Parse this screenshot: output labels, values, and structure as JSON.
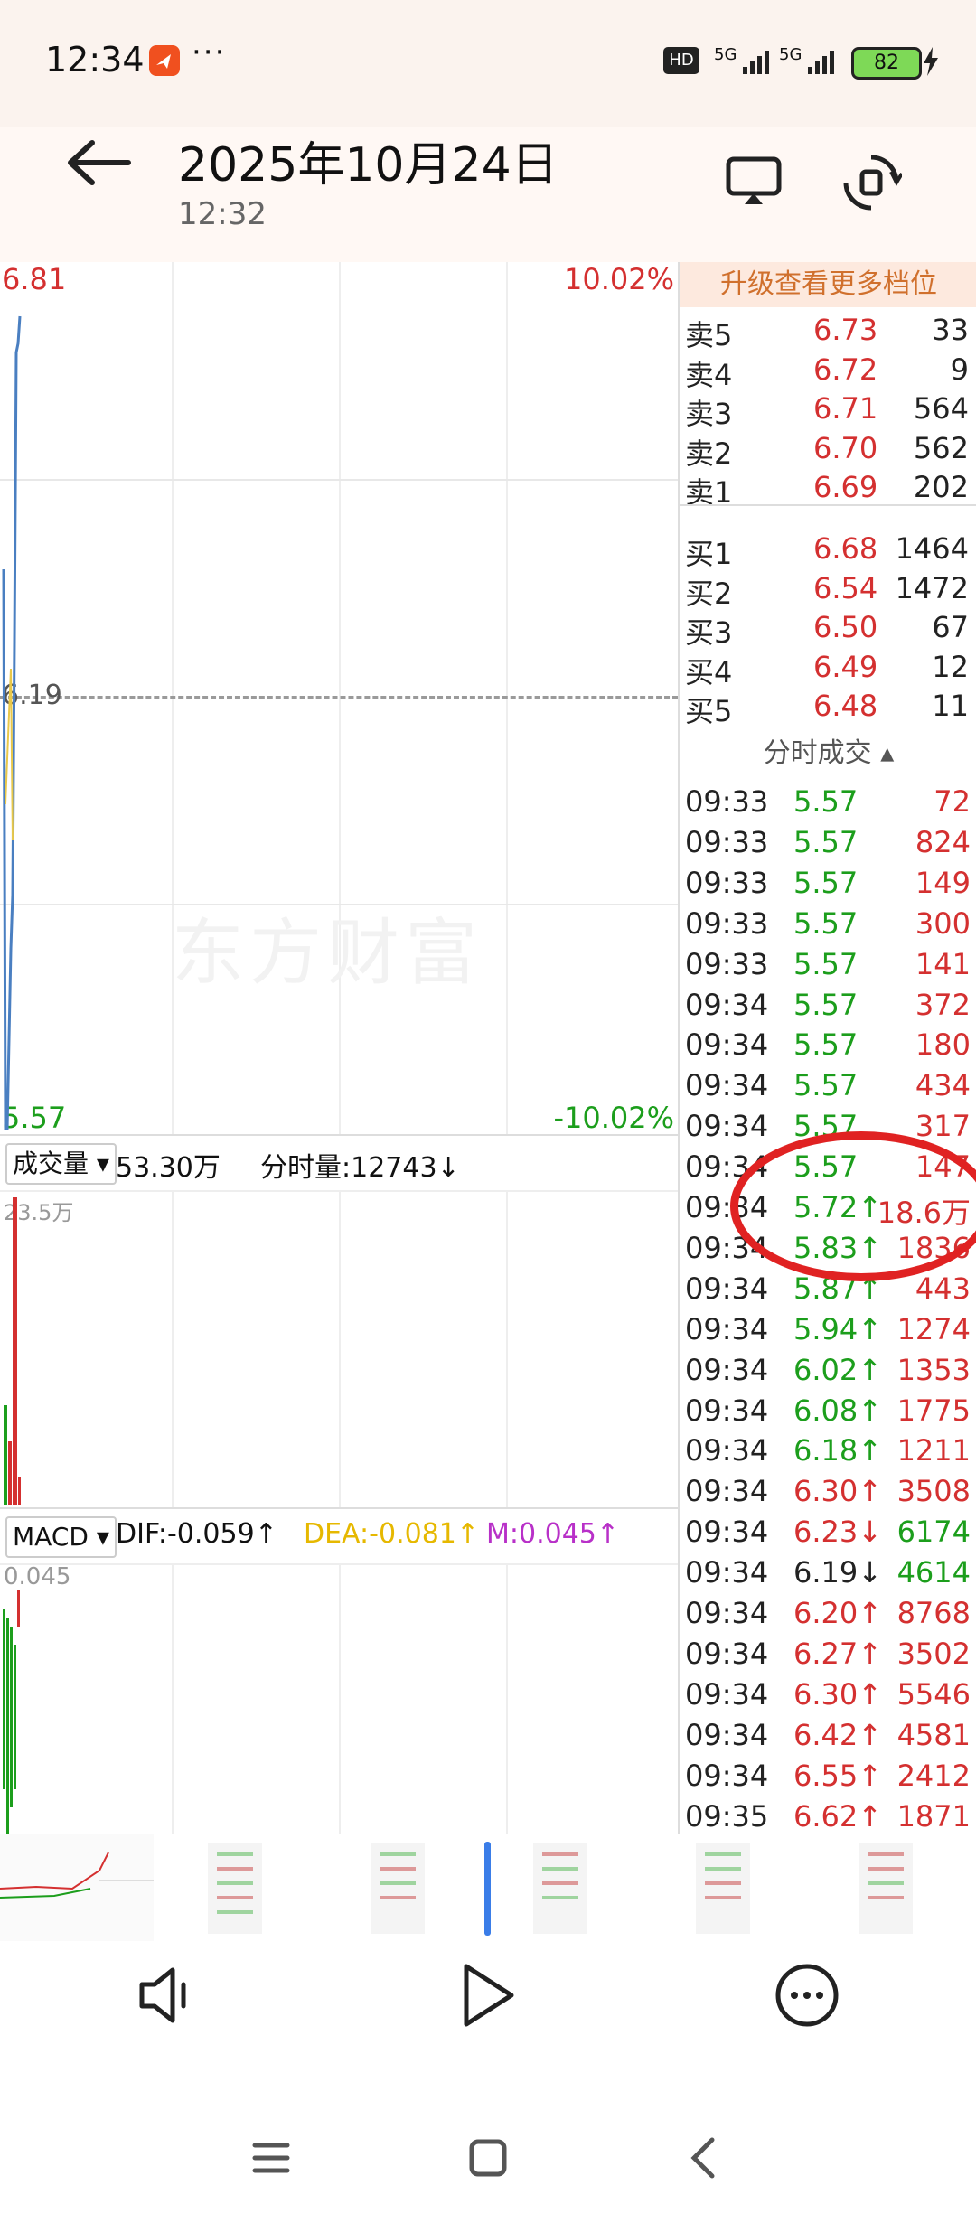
{
  "status_bar": {
    "time": "12:34",
    "dots": "···",
    "hd_badge": "HD",
    "network_1": "5G",
    "network_2": "5G",
    "battery": "82",
    "app_icon": "app-notification-icon"
  },
  "header": {
    "date_title": "2025年10月24日",
    "time_subtitle": "12:32",
    "back_icon": "arrow-left-icon",
    "cast_icon": "cast-screen-icon",
    "rotate_icon": "rotate-screen-icon"
  },
  "chart": {
    "top_price_label": "6.81",
    "top_pct_label": "10.02%",
    "mid_price_label": "6.19",
    "bottom_price_label": "5.57",
    "bottom_pct_label": "-10.02%",
    "watermark": "东方财富",
    "volume_header": {
      "selector_label": "成交量",
      "total": "53.30万",
      "tick_volume": "分时量:12743↓"
    },
    "volume_axis_label": "23.5万",
    "macd_header": {
      "selector_label": "MACD",
      "dif": "DIF:-0.059↑",
      "dea": "DEA:-0.081↑",
      "m": "M:0.045↑"
    },
    "macd_axis_label": "0.045",
    "colors": {
      "up": "#d43030",
      "down": "#1c9e1c",
      "price_line": "#4a7fc1",
      "avg_line": "#e8c84a",
      "dea": "#e6b800",
      "m": "#b830c8"
    }
  },
  "order_book": {
    "upgrade_label": "升级查看更多档位",
    "asks": [
      {
        "label": "卖5",
        "price": "6.73",
        "volume": "33"
      },
      {
        "label": "卖4",
        "price": "6.72",
        "volume": "9"
      },
      {
        "label": "卖3",
        "price": "6.71",
        "volume": "564"
      },
      {
        "label": "卖2",
        "price": "6.70",
        "volume": "562"
      },
      {
        "label": "卖1",
        "price": "6.69",
        "volume": "202"
      }
    ],
    "bids": [
      {
        "label": "买1",
        "price": "6.68",
        "volume": "1464"
      },
      {
        "label": "买2",
        "price": "6.54",
        "volume": "1472"
      },
      {
        "label": "买3",
        "price": "6.50",
        "volume": "67"
      },
      {
        "label": "买4",
        "price": "6.49",
        "volume": "12"
      },
      {
        "label": "买5",
        "price": "6.48",
        "volume": "11"
      }
    ]
  },
  "trades": {
    "title": "分时成交 ▴",
    "rows": [
      {
        "time": "09:33",
        "price": "5.57",
        "volume": "72",
        "pc": "green",
        "vc": "red"
      },
      {
        "time": "09:33",
        "price": "5.57",
        "volume": "824",
        "pc": "green",
        "vc": "red"
      },
      {
        "time": "09:33",
        "price": "5.57",
        "volume": "149",
        "pc": "green",
        "vc": "red"
      },
      {
        "time": "09:33",
        "price": "5.57",
        "volume": "300",
        "pc": "green",
        "vc": "red"
      },
      {
        "time": "09:33",
        "price": "5.57",
        "volume": "141",
        "pc": "green",
        "vc": "red"
      },
      {
        "time": "09:34",
        "price": "5.57",
        "volume": "372",
        "pc": "green",
        "vc": "red"
      },
      {
        "time": "09:34",
        "price": "5.57",
        "volume": "180",
        "pc": "green",
        "vc": "red"
      },
      {
        "time": "09:34",
        "price": "5.57",
        "volume": "434",
        "pc": "green",
        "vc": "red"
      },
      {
        "time": "09:34",
        "price": "5.57",
        "volume": "317",
        "pc": "green",
        "vc": "red"
      },
      {
        "time": "09:34",
        "price": "5.57",
        "volume": "147",
        "pc": "green",
        "vc": "red"
      },
      {
        "time": "09:34",
        "price": "5.72↑",
        "volume": "18.6万",
        "pc": "green",
        "vc": "red"
      },
      {
        "time": "09:34",
        "price": "5.83↑",
        "volume": "1836",
        "pc": "green",
        "vc": "red"
      },
      {
        "time": "09:34",
        "price": "5.87↑",
        "volume": "443",
        "pc": "green",
        "vc": "red"
      },
      {
        "time": "09:34",
        "price": "5.94↑",
        "volume": "1274",
        "pc": "green",
        "vc": "red"
      },
      {
        "time": "09:34",
        "price": "6.02↑",
        "volume": "1353",
        "pc": "green",
        "vc": "red"
      },
      {
        "time": "09:34",
        "price": "6.08↑",
        "volume": "1775",
        "pc": "green",
        "vc": "red"
      },
      {
        "time": "09:34",
        "price": "6.18↑",
        "volume": "1211",
        "pc": "green",
        "vc": "red"
      },
      {
        "time": "09:34",
        "price": "6.30↑",
        "volume": "3508",
        "pc": "red",
        "vc": "red"
      },
      {
        "time": "09:34",
        "price": "6.23↓",
        "volume": "6174",
        "pc": "red",
        "vc": "green"
      },
      {
        "time": "09:34",
        "price": "6.19↓",
        "volume": "4614",
        "pc": "dark",
        "vc": "green"
      },
      {
        "time": "09:34",
        "price": "6.20↑",
        "volume": "8768",
        "pc": "red",
        "vc": "red"
      },
      {
        "time": "09:34",
        "price": "6.27↑",
        "volume": "3502",
        "pc": "red",
        "vc": "red"
      },
      {
        "time": "09:34",
        "price": "6.30↑",
        "volume": "5546",
        "pc": "red",
        "vc": "red"
      },
      {
        "time": "09:34",
        "price": "6.42↑",
        "volume": "4581",
        "pc": "red",
        "vc": "red"
      },
      {
        "time": "09:34",
        "price": "6.55↑",
        "volume": "2412",
        "pc": "red",
        "vc": "red"
      },
      {
        "time": "09:35",
        "price": "6.62↑",
        "volume": "1871",
        "pc": "red",
        "vc": "red"
      }
    ]
  },
  "playback": {
    "volume_icon": "speaker-icon",
    "play_icon": "play-icon",
    "more_icon": "more-options-icon"
  },
  "nav_bar": {
    "menu_icon": "menu-icon",
    "home_icon": "home-icon",
    "back_icon": "back-icon"
  }
}
